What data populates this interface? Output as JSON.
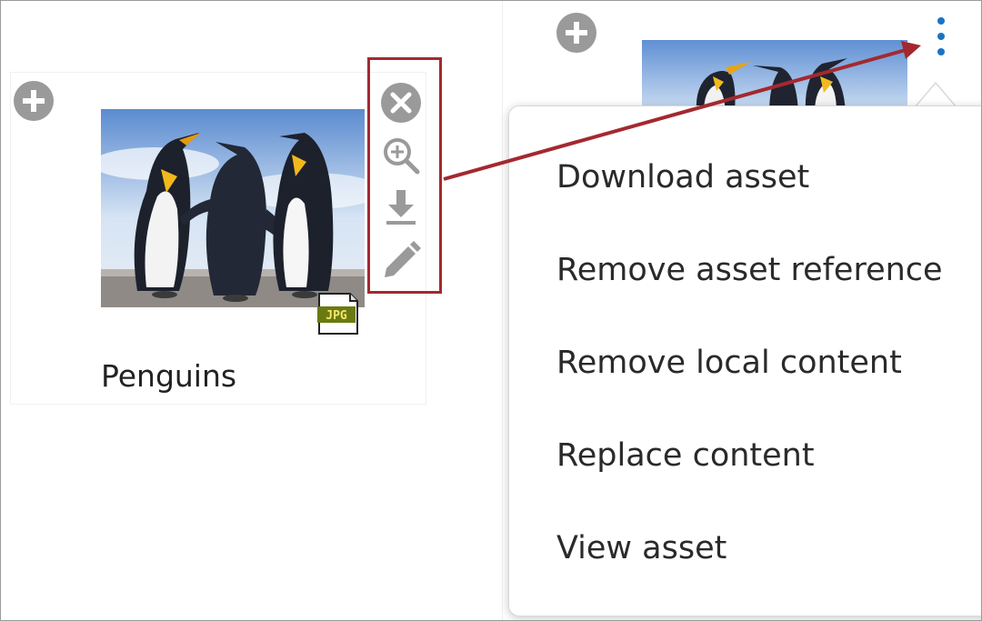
{
  "card": {
    "title": "Penguins",
    "file_type": "JPG"
  },
  "actions": [
    {
      "icon": "close-circle-icon"
    },
    {
      "icon": "zoom-in-icon"
    },
    {
      "icon": "download-icon"
    },
    {
      "icon": "pencil-edit-icon"
    }
  ],
  "menu": {
    "items": [
      "Download asset",
      "Remove asset reference",
      "Remove local content",
      "Replace content",
      "View asset"
    ]
  },
  "colors": {
    "highlight": "#a3292f",
    "kebab": "#1a73c9",
    "icon_gray": "#9a9a9a",
    "file_badge": "#6b7a10"
  }
}
